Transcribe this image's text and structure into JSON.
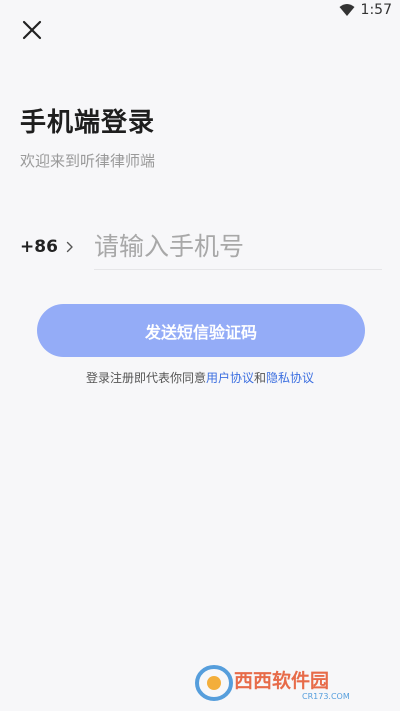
{
  "status_bar": {
    "time": "1:57",
    "icons": [
      "wifi-icon"
    ]
  },
  "nav": {
    "close_icon": "close-icon"
  },
  "login": {
    "title": "手机端登录",
    "subtitle": "欢迎来到听律律师端",
    "country_code": "+86",
    "phone_placeholder": "请输入手机号",
    "phone_value": "",
    "send_code_label": "发送短信验证码"
  },
  "agreement": {
    "prefix": "登录注册即代表你同意",
    "user_agreement": "用户协议",
    "conjunction": "和",
    "privacy_agreement": "隐私协议"
  },
  "watermark": {
    "text": "西西软件园",
    "url_text": "CR173.COM"
  },
  "colors": {
    "background": "#f7f7f9",
    "primary_button": "#94acf7",
    "link": "#3c6fe0",
    "subtitle": "#9a9a9a"
  }
}
